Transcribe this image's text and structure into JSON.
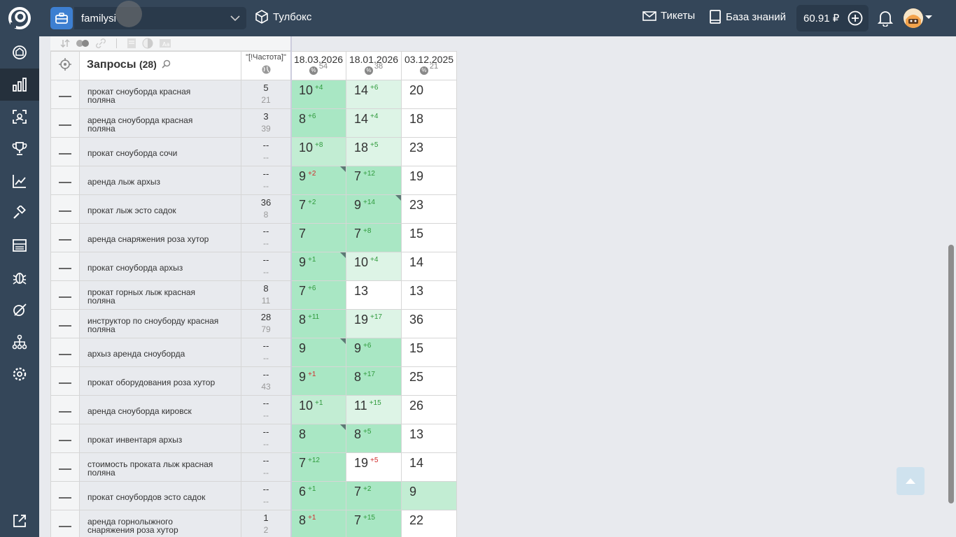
{
  "header": {
    "project_name": "familysi",
    "toolbox_label": "Тулбокс",
    "tickets_label": "Тикеты",
    "kb_label": "База знаний",
    "balance": "60.91 ₽"
  },
  "sidebar": {
    "items": [
      {
        "icon": "dashboard-icon",
        "active": false
      },
      {
        "icon": "chart-bars-icon",
        "active": true
      },
      {
        "icon": "screen-scan-icon",
        "active": false
      },
      {
        "icon": "trophy-icon",
        "active": false
      },
      {
        "icon": "trend-line-icon",
        "active": false
      },
      {
        "icon": "tools-icon",
        "active": false
      },
      {
        "icon": "server-icon",
        "active": false
      },
      {
        "icon": "bug-icon",
        "active": false
      },
      {
        "icon": "leaf-icon",
        "active": false
      },
      {
        "icon": "sitemap-icon",
        "active": false
      },
      {
        "icon": "settings-icon",
        "active": false
      },
      {
        "icon": "external-link-icon",
        "active": false
      }
    ]
  },
  "table": {
    "title": "Запросы",
    "count": "(28)",
    "freq_header": "\"[!Частота]\"",
    "dates": [
      {
        "label": "18.03.2026",
        "count": "54"
      },
      {
        "label": "18.01.2026",
        "count": "38"
      },
      {
        "label": "03.12.2025",
        "count": "21"
      }
    ],
    "rows": [
      {
        "q": [
          "прокат сноуборда красная",
          "поляна"
        ],
        "f": "5",
        "fs": "21",
        "p": [
          {
            "v": "10",
            "d": "+4",
            "dir": "up",
            "bg": "g1",
            "c": false
          },
          {
            "v": "14",
            "d": "+6",
            "dir": "up",
            "bg": "g3",
            "c": false
          },
          {
            "v": "20",
            "d": "",
            "dir": "",
            "bg": "w",
            "c": false
          }
        ]
      },
      {
        "q": [
          "аренда сноуборда красная",
          "поляна"
        ],
        "f": "3",
        "fs": "39",
        "p": [
          {
            "v": "8",
            "d": "+6",
            "dir": "up",
            "bg": "g1",
            "c": false
          },
          {
            "v": "14",
            "d": "+4",
            "dir": "up",
            "bg": "g3",
            "c": false
          },
          {
            "v": "18",
            "d": "",
            "dir": "",
            "bg": "w",
            "c": false
          }
        ]
      },
      {
        "q": [
          "прокат сноуборда сочи"
        ],
        "f": "--",
        "fs": "--",
        "p": [
          {
            "v": "10",
            "d": "+8",
            "dir": "up",
            "bg": "g2",
            "c": false
          },
          {
            "v": "18",
            "d": "+5",
            "dir": "up",
            "bg": "g3",
            "c": false
          },
          {
            "v": "23",
            "d": "",
            "dir": "",
            "bg": "w",
            "c": false
          }
        ]
      },
      {
        "q": [
          "аренда лыж архыз"
        ],
        "f": "--",
        "fs": "--",
        "p": [
          {
            "v": "9",
            "d": "+2",
            "dir": "dn",
            "bg": "g1",
            "c": true
          },
          {
            "v": "7",
            "d": "+12",
            "dir": "up",
            "bg": "g1",
            "c": false
          },
          {
            "v": "19",
            "d": "",
            "dir": "",
            "bg": "w",
            "c": false
          }
        ]
      },
      {
        "q": [
          "прокат лыж эсто садок"
        ],
        "f": "36",
        "fs": "8",
        "p": [
          {
            "v": "7",
            "d": "+2",
            "dir": "up",
            "bg": "g1",
            "c": false
          },
          {
            "v": "9",
            "d": "+14",
            "dir": "up",
            "bg": "g1",
            "c": true
          },
          {
            "v": "23",
            "d": "",
            "dir": "",
            "bg": "w",
            "c": false
          }
        ]
      },
      {
        "q": [
          "аренда снаряжения роза хутор"
        ],
        "f": "--",
        "fs": "--",
        "p": [
          {
            "v": "7",
            "d": "",
            "dir": "",
            "bg": "g1",
            "c": false
          },
          {
            "v": "7",
            "d": "+8",
            "dir": "up",
            "bg": "g1",
            "c": false
          },
          {
            "v": "15",
            "d": "",
            "dir": "",
            "bg": "w",
            "c": false
          }
        ]
      },
      {
        "q": [
          "прокат сноуборда архыз"
        ],
        "f": "--",
        "fs": "--",
        "p": [
          {
            "v": "9",
            "d": "+1",
            "dir": "up",
            "bg": "g1",
            "c": true
          },
          {
            "v": "10",
            "d": "+4",
            "dir": "up",
            "bg": "g3",
            "c": false
          },
          {
            "v": "14",
            "d": "",
            "dir": "",
            "bg": "w",
            "c": false
          }
        ]
      },
      {
        "q": [
          "прокат горных лыж красная",
          "поляна"
        ],
        "f": "8",
        "fs": "11",
        "p": [
          {
            "v": "7",
            "d": "+6",
            "dir": "up",
            "bg": "g1",
            "c": false
          },
          {
            "v": "13",
            "d": "",
            "dir": "",
            "bg": "w",
            "c": false
          },
          {
            "v": "13",
            "d": "",
            "dir": "",
            "bg": "w",
            "c": false
          }
        ]
      },
      {
        "q": [
          "инструктор по сноуборду красная",
          "поляна"
        ],
        "f": "28",
        "fs": "79",
        "p": [
          {
            "v": "8",
            "d": "+11",
            "dir": "up",
            "bg": "g1",
            "c": false
          },
          {
            "v": "19",
            "d": "+17",
            "dir": "up",
            "bg": "g3",
            "c": false
          },
          {
            "v": "36",
            "d": "",
            "dir": "",
            "bg": "w",
            "c": false
          }
        ]
      },
      {
        "q": [
          "архыз аренда сноуборда"
        ],
        "f": "--",
        "fs": "--",
        "p": [
          {
            "v": "9",
            "d": "",
            "dir": "",
            "bg": "g1",
            "c": true
          },
          {
            "v": "9",
            "d": "+6",
            "dir": "up",
            "bg": "g1",
            "c": false
          },
          {
            "v": "15",
            "d": "",
            "dir": "",
            "bg": "w",
            "c": false
          }
        ]
      },
      {
        "q": [
          "прокат оборудования роза хутор"
        ],
        "f": "--",
        "fs": "43",
        "p": [
          {
            "v": "9",
            "d": "+1",
            "dir": "dn",
            "bg": "g1",
            "c": false
          },
          {
            "v": "8",
            "d": "+17",
            "dir": "up",
            "bg": "g1",
            "c": false
          },
          {
            "v": "25",
            "d": "",
            "dir": "",
            "bg": "w",
            "c": false
          }
        ]
      },
      {
        "q": [
          "аренда сноуборда кировск"
        ],
        "f": "--",
        "fs": "--",
        "p": [
          {
            "v": "10",
            "d": "+1",
            "dir": "up",
            "bg": "g2",
            "c": false
          },
          {
            "v": "11",
            "d": "+15",
            "dir": "up",
            "bg": "g3",
            "c": false
          },
          {
            "v": "26",
            "d": "",
            "dir": "",
            "bg": "w",
            "c": false
          }
        ]
      },
      {
        "q": [
          "прокат инвентаря архыз"
        ],
        "f": "--",
        "fs": "--",
        "p": [
          {
            "v": "8",
            "d": "",
            "dir": "",
            "bg": "g1",
            "c": true
          },
          {
            "v": "8",
            "d": "+5",
            "dir": "up",
            "bg": "g1",
            "c": false
          },
          {
            "v": "13",
            "d": "",
            "dir": "",
            "bg": "w",
            "c": false
          }
        ]
      },
      {
        "q": [
          "стоимость проката лыж красная",
          "поляна"
        ],
        "f": "--",
        "fs": "--",
        "p": [
          {
            "v": "7",
            "d": "+12",
            "dir": "up",
            "bg": "g1",
            "c": false
          },
          {
            "v": "19",
            "d": "+5",
            "dir": "dn",
            "bg": "w",
            "c": false
          },
          {
            "v": "14",
            "d": "",
            "dir": "",
            "bg": "w",
            "c": false
          }
        ]
      },
      {
        "q": [
          "прокат сноубордов эсто садок"
        ],
        "f": "--",
        "fs": "--",
        "p": [
          {
            "v": "6",
            "d": "+1",
            "dir": "up",
            "bg": "g1",
            "c": false
          },
          {
            "v": "7",
            "d": "+2",
            "dir": "up",
            "bg": "g1",
            "c": false
          },
          {
            "v": "9",
            "d": "",
            "dir": "",
            "bg": "g2",
            "c": false
          }
        ]
      },
      {
        "q": [
          "аренда горнолыжного",
          "снаряжения роза хутор"
        ],
        "f": "1",
        "fs": "2",
        "p": [
          {
            "v": "8",
            "d": "+1",
            "dir": "dn",
            "bg": "g1",
            "c": false
          },
          {
            "v": "7",
            "d": "+15",
            "dir": "up",
            "bg": "g1",
            "c": false
          },
          {
            "v": "22",
            "d": "",
            "dir": "",
            "bg": "w",
            "c": false
          }
        ]
      }
    ]
  }
}
